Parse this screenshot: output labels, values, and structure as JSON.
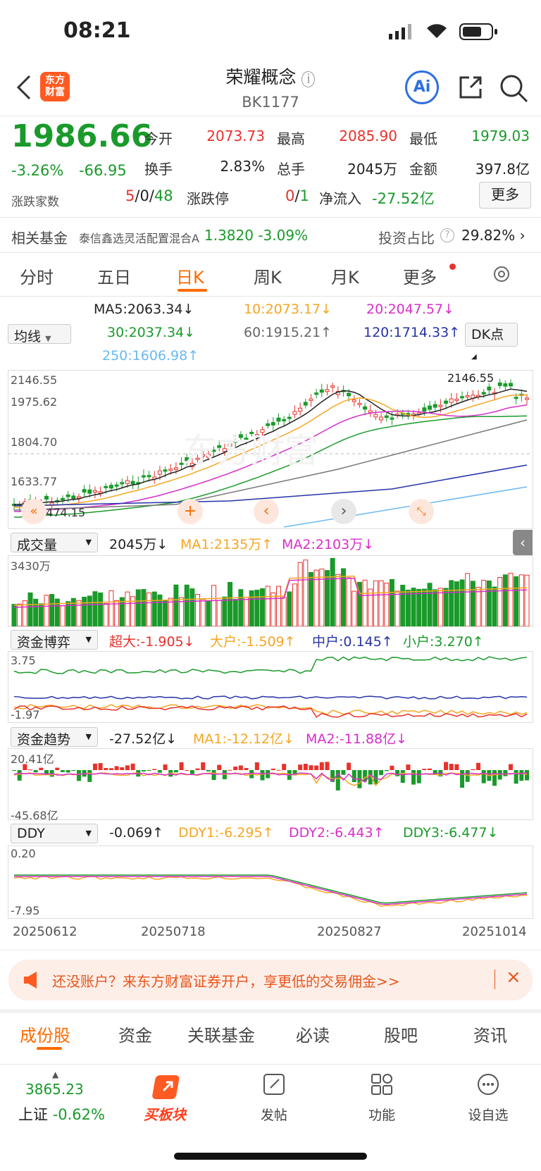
{
  "status": {
    "time": "08:21"
  },
  "header": {
    "title": "荣耀概念",
    "code": "BK1177",
    "logo": "东方\n财富",
    "ai": "Ai"
  },
  "quote": {
    "price": "1986.66",
    "chg_pct": "-3.26%",
    "chg": "-66.95",
    "open_lbl": "今开",
    "open": "2073.73",
    "high_lbl": "最高",
    "high": "2085.90",
    "low_lbl": "最低",
    "low": "1979.03",
    "turn_lbl": "换手",
    "turn": "2.83%",
    "vol_lbl": "总手",
    "vol": "2045万",
    "amt_lbl": "金额",
    "amt": "397.8亿",
    "adv_lbl": "涨跌家数",
    "adv_up": "5",
    "adv_flat": "0",
    "adv_down": "48",
    "lim_lbl": "涨跌停",
    "lim_up": "0",
    "lim_down": "1",
    "flow_lbl": "净流入",
    "flow": "-27.52亿",
    "more": "更多"
  },
  "fund": {
    "label": "相关基金",
    "name": "泰信鑫选灵活配置混合A",
    "nav": "1.3820",
    "chg": "-3.09%",
    "ratio_lbl": "投资占比",
    "ratio": "29.82%"
  },
  "tabs": [
    "分时",
    "五日",
    "日K",
    "周K",
    "月K",
    "更多"
  ],
  "ma": {
    "sel": "均线",
    "ma5": "MA5:2063.34↓",
    "ma10": "10:2073.17↓",
    "ma20": "20:2047.57↓",
    "ma30": "30:2037.34↓",
    "ma60": "60:1915.21↑",
    "ma120": "120:1714.33↑",
    "ma250": "250:1606.98↑",
    "dk": "DK点"
  },
  "kline": {
    "y1": "2146.55",
    "y2": "1975.62",
    "y3": "1804.70",
    "y4": "1633.77",
    "y5": "1474.15",
    "peak": "2146.55"
  },
  "volume": {
    "sel": "成交量",
    "v": "2045万↓",
    "ma1": "MA1:2135万↑",
    "ma2": "MA2:2103万↓",
    "top": "3430万"
  },
  "game": {
    "sel": "资金博弈",
    "a": "超大:-1.905↓",
    "b": "大户:-1.509↑",
    "c": "中户:0.145↑",
    "d": "小户:3.270↑",
    "top": "3.75",
    "bot": "-1.97"
  },
  "trend": {
    "sel": "资金趋势",
    "v": "-27.52亿↓",
    "ma1": "MA1:-12.12亿↓",
    "ma2": "MA2:-11.88亿↓",
    "top": "20.41亿",
    "bot": "-45.68亿"
  },
  "ddy": {
    "sel": "DDY",
    "v": "-0.069↑",
    "d1": "DDY1:-6.295↑",
    "d2": "DDY2:-6.443↑",
    "d3": "DDY3:-6.477↓",
    "top": "0.20",
    "bot": "-7.95"
  },
  "dates": [
    "20250612",
    "20250718",
    "20250827",
    "20251014"
  ],
  "banner": {
    "text": "还没账户？来东方财富证券开户，享更低的交易佣金>>"
  },
  "bottom_tabs": [
    "成份股",
    "资金",
    "关联基金",
    "必读",
    "股吧",
    "资讯"
  ],
  "nav": {
    "index": "3865.23",
    "index_name": "上证",
    "index_chg": "-0.62%",
    "buy": "买板块",
    "post": "发帖",
    "func": "功能",
    "watch": "设自选"
  },
  "colors": {
    "up": "#e8312b",
    "down": "#1a9a2a",
    "accent": "#ff6a00"
  }
}
